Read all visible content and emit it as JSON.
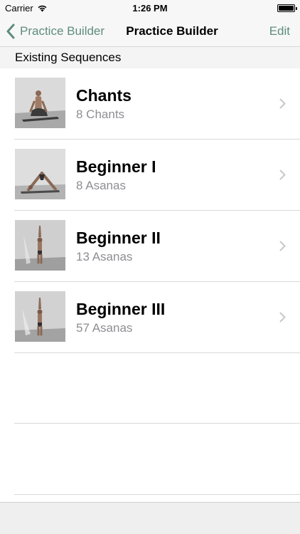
{
  "status_bar": {
    "carrier": "Carrier",
    "time": "1:26 PM",
    "wifi_icon": "wifi-icon",
    "battery_icon": "battery-icon"
  },
  "nav": {
    "back_label": "Practice Builder",
    "title": "Practice Builder",
    "edit_label": "Edit",
    "accent_color": "#5f8c7f"
  },
  "section": {
    "header": "Existing Sequences"
  },
  "sequences": [
    {
      "title": "Chants",
      "subtitle": "8 Chants"
    },
    {
      "title": "Beginner I",
      "subtitle": "8 Asanas"
    },
    {
      "title": "Beginner II",
      "subtitle": "13 Asanas"
    },
    {
      "title": "Beginner III",
      "subtitle": "57 Asanas"
    }
  ]
}
